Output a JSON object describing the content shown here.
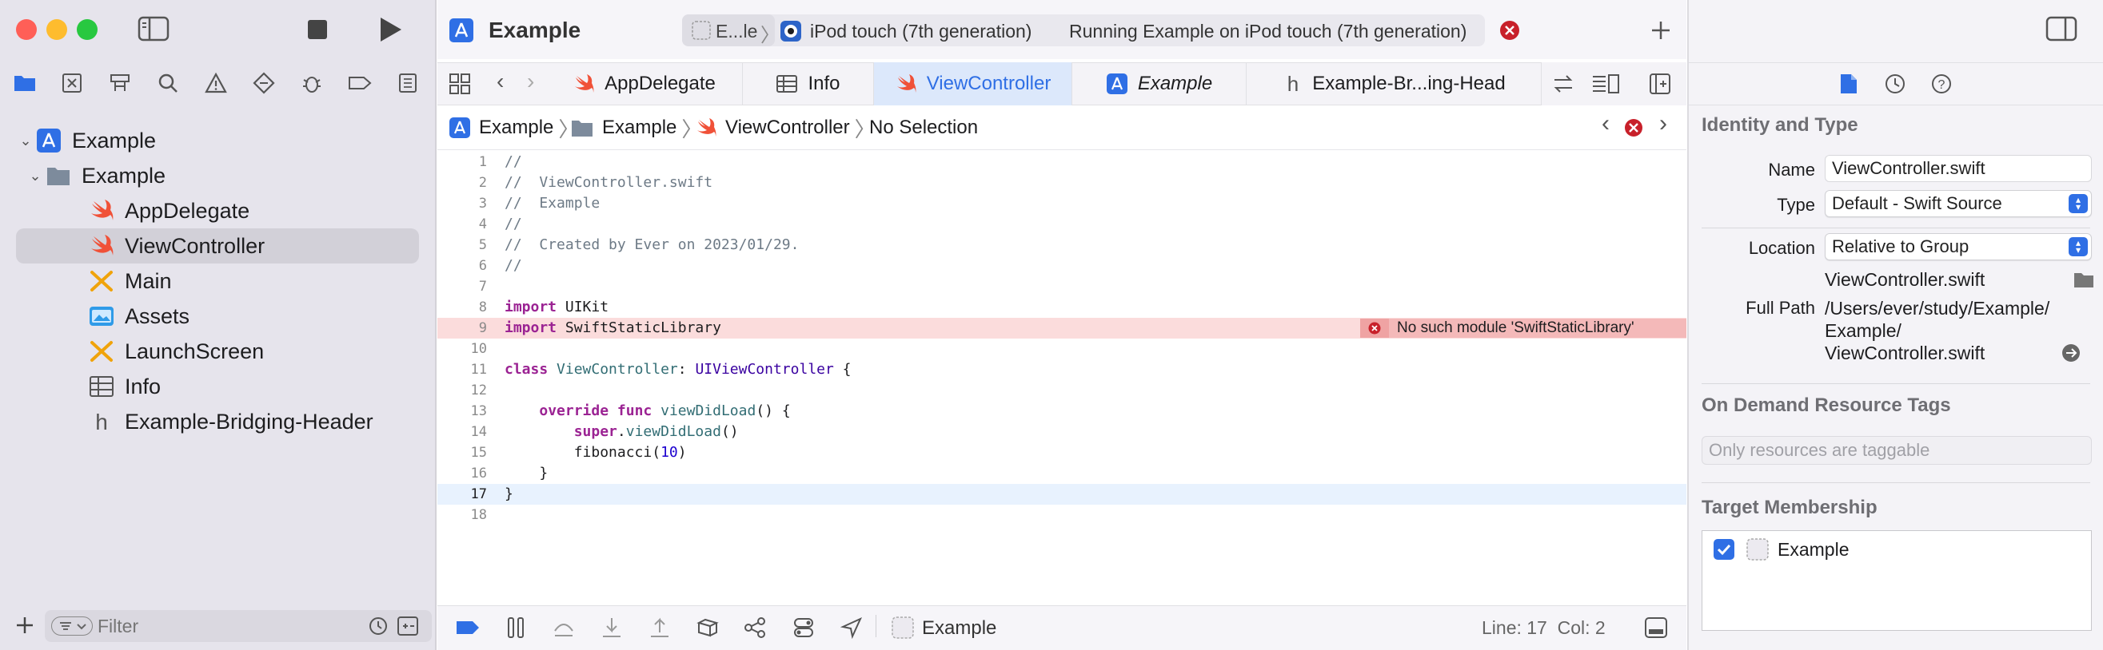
{
  "window": {
    "project_title": "Example"
  },
  "toolbar": {
    "scheme_short": "E...le",
    "device": "iPod touch (7th generation)",
    "status": "Running Example on iPod touch (7th generation)"
  },
  "navigator": {
    "tree": [
      {
        "label": "Example",
        "kind": "project"
      },
      {
        "label": "Example",
        "kind": "folder"
      },
      {
        "label": "AppDelegate",
        "kind": "swift"
      },
      {
        "label": "ViewController",
        "kind": "swift",
        "selected": true
      },
      {
        "label": "Main",
        "kind": "storyboard"
      },
      {
        "label": "Assets",
        "kind": "assets"
      },
      {
        "label": "LaunchScreen",
        "kind": "storyboard"
      },
      {
        "label": "Info",
        "kind": "plist"
      },
      {
        "label": "Example-Bridging-Header",
        "kind": "header"
      }
    ],
    "filter_placeholder": "Filter"
  },
  "tabs": [
    {
      "label": "AppDelegate",
      "icon": "swift-icon"
    },
    {
      "label": "Info",
      "icon": "table-icon"
    },
    {
      "label": "ViewController",
      "icon": "swift-icon",
      "active": true
    },
    {
      "label": "Example",
      "icon": "project-icon"
    },
    {
      "label": "Example-Br...ing-Head",
      "icon": "header-icon"
    }
  ],
  "breadcrumb": [
    "Example",
    "Example",
    "ViewController",
    "No Selection"
  ],
  "code": {
    "lines": [
      "//",
      "//  ViewController.swift",
      "//  Example",
      "//",
      "//  Created by Ever on 2023/01/29.",
      "//",
      "",
      "import UIKit",
      "import SwiftStaticLibrary",
      "",
      "class ViewController: UIViewController {",
      "",
      "    override func viewDidLoad() {",
      "        super.viewDidLoad()",
      "        fibonacci(10)",
      "    }",
      "}",
      ""
    ],
    "error_line": 9,
    "current_line": 17,
    "error_message": "No such module 'SwiftStaticLibrary'"
  },
  "debugbar": {
    "target": "Example",
    "line_col": "Line: 17  Col: 2"
  },
  "inspector": {
    "identity_title": "Identity and Type",
    "name_label": "Name",
    "name_value": "ViewController.swift",
    "type_label": "Type",
    "type_value": "Default - Swift Source",
    "location_label": "Location",
    "location_value": "Relative to Group",
    "location_file": "ViewController.swift",
    "fullpath_label": "Full Path",
    "fullpath_lines": [
      "/Users/ever/study/Example/",
      "Example/",
      "ViewController.swift"
    ],
    "odr_title": "On Demand Resource Tags",
    "odr_placeholder": "Only resources are taggable",
    "target_title": "Target Membership",
    "target_name": "Example"
  },
  "colors": {
    "accent": "#2f6fe5",
    "error": "#c8202a",
    "error_bg": "#fbdcdc",
    "sidebar_bg": "#e6e4ec",
    "swift": "#f05138"
  }
}
